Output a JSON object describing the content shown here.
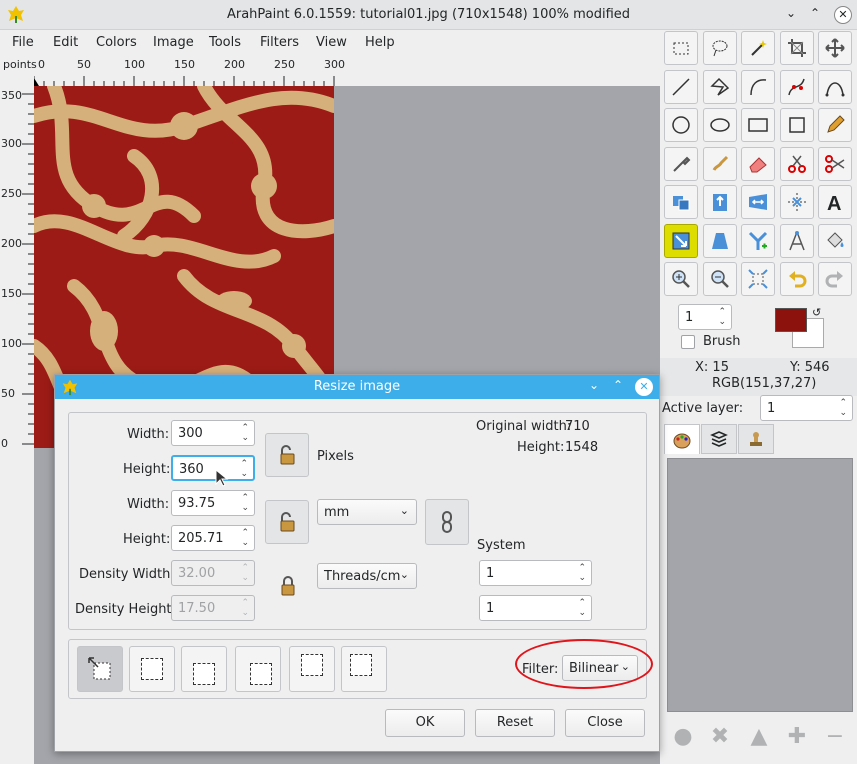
{
  "window": {
    "title": "ArahPaint 6.0.1559: tutorial01.jpg (710x1548) 100% modified"
  },
  "menu": [
    "File",
    "Edit",
    "Colors",
    "Image",
    "Tools",
    "Filters",
    "View",
    "Help"
  ],
  "ruler": {
    "unit": "points",
    "top_ticks": [
      "0",
      "50",
      "100",
      "150",
      "200",
      "250",
      "300"
    ],
    "left_ticks": [
      "350",
      "300",
      "250",
      "200",
      "150",
      "100",
      "50",
      "0"
    ]
  },
  "tools": {
    "rows": [
      [
        "rect-select-icon",
        "lasso-icon",
        "magic-wand-icon",
        "crop-icon",
        "move-icon"
      ],
      [
        "line-icon",
        "polygon-icon",
        "curve-icon",
        "bezier-icon",
        "path-icon"
      ],
      [
        "ellipse-icon",
        "oval-icon",
        "rectangle-icon",
        "square-icon",
        "pencil-icon"
      ],
      [
        "eyedropper-icon",
        "brush-icon",
        "eraser-icon",
        "cut-icon",
        "scissors-icon"
      ],
      [
        "flip-icon",
        "stretch-up-icon",
        "stretch-horizontal-icon",
        "transform-icon",
        "text-icon"
      ],
      [
        "resize-icon",
        "perspective-icon",
        "y-tool-icon",
        "compass-icon",
        "fill-icon"
      ],
      [
        "zoom-in-icon",
        "zoom-out-icon",
        "fit-icon",
        "undo-icon",
        "redo-icon"
      ]
    ]
  },
  "brush": {
    "size": "1",
    "label": "Brush"
  },
  "colors": {
    "foreground": "#8c120e",
    "background": "#ffffff",
    "accent": "#3daee9"
  },
  "status": {
    "x": "X: 15",
    "y": "Y: 546",
    "rgb": "RGB(151,37,27)"
  },
  "layers": {
    "label": "Active layer:",
    "value": "1"
  },
  "dialog": {
    "title": "Resize image",
    "pixel_width_label": "Width:",
    "pixel_width": "300",
    "pixel_height_label": "Height:",
    "pixel_height": "360",
    "pixels_label": "Pixels",
    "mm_width_label": "Width:",
    "mm_width": "93.75",
    "mm_height_label": "Height:",
    "mm_height": "205.71",
    "unit": "mm",
    "density_width_label": "Density Width:",
    "density_width": "32.00",
    "density_height_label": "Density Height:",
    "density_height": "17.50",
    "density_unit": "Threads/cm",
    "original_width_label": "Original width:",
    "original_width": "710",
    "original_height_label": "Height:",
    "original_height": "1548",
    "system_label": "System",
    "system_value1": "1",
    "system_value2": "1",
    "filter_label": "Filter:",
    "filter": "Bilinear",
    "ok": "OK",
    "reset": "Reset",
    "close": "Close"
  }
}
